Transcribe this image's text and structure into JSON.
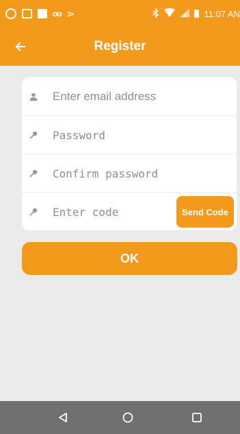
{
  "status_bar": {
    "time": "11:07 AN",
    "left_icons": [
      "whatsapp-icon",
      "gallery-icon",
      "square-icon",
      "voicemail-icon",
      "send-icon"
    ],
    "right_icons": [
      "bluetooth-icon",
      "wifi-icon",
      "signal-icon",
      "battery-icon"
    ],
    "voicemail_glyph": "oo",
    "send_glyph": "⋗"
  },
  "app_bar": {
    "title": "Register",
    "back_icon": "arrow-left-icon"
  },
  "form": {
    "email": {
      "placeholder": "Enter email address",
      "value": "",
      "icon": "person-icon"
    },
    "password": {
      "placeholder": "Password",
      "value": "",
      "icon": "key-icon"
    },
    "confirm_password": {
      "placeholder": "Confirm password",
      "value": "",
      "icon": "key-icon"
    },
    "code": {
      "placeholder": "Enter code",
      "value": "",
      "icon": "key-icon"
    },
    "send_code_label": "Send Code"
  },
  "ok_label": "OK",
  "nav": {
    "back": "triangle-back-icon",
    "home": "circle-home-icon",
    "recents": "square-recents-icon"
  },
  "colors": {
    "accent": "#f39a1c",
    "background": "#ebebeb",
    "card": "#ffffff",
    "nav_bar": "#6f6f6f",
    "placeholder": "#8f8f8f"
  }
}
